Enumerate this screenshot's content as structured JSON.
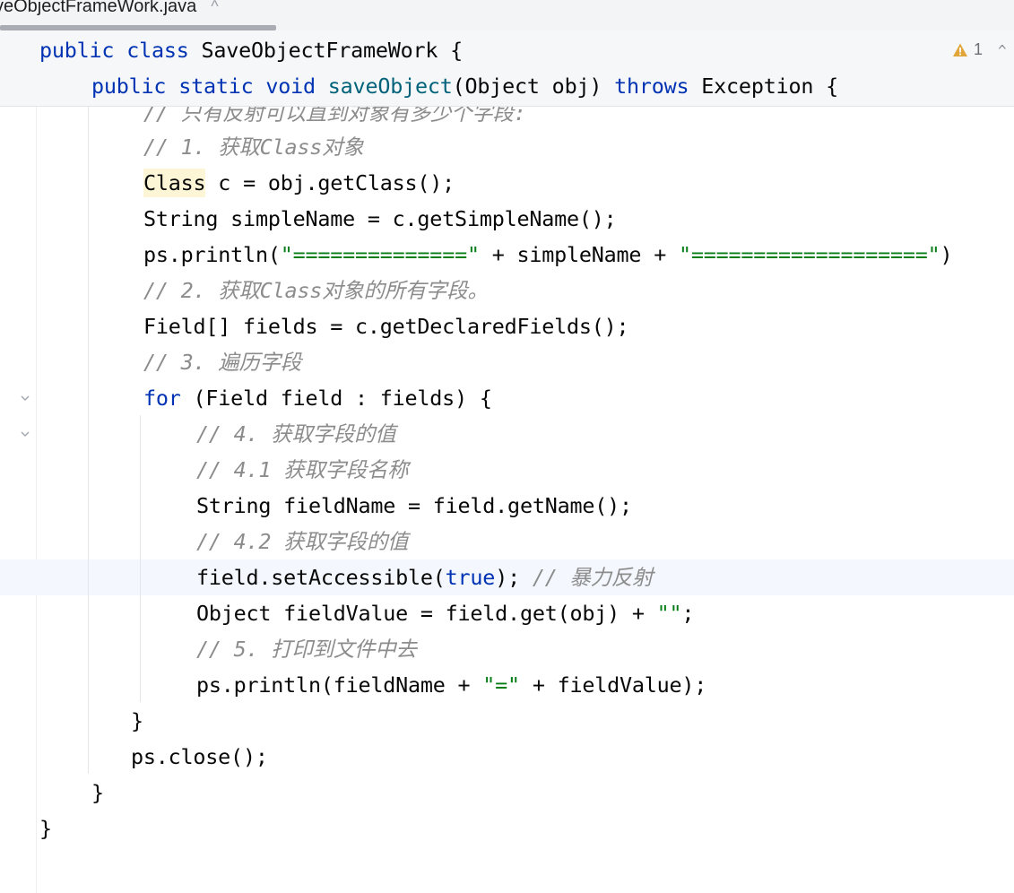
{
  "tab": {
    "title": "veObjectFrameWork.java",
    "close_glyph": "^"
  },
  "inspections": {
    "warning_count": "1",
    "nav_glyph": "^"
  },
  "code": {
    "l0": {
      "kw1": "public",
      "kw2": "class",
      "name": "SaveObjectFrameWork",
      "rest": " {"
    },
    "l1": {
      "kw1": "public",
      "kw2": "static",
      "kw3": "void",
      "fn": "saveObject",
      "mid": "(Object obj) ",
      "kw4": "throws",
      "rest": " Exception {"
    },
    "l2": {
      "cmt": "// 只有反射可以直到对象有多少个字段:"
    },
    "l3": {
      "cmt": "// 1. 获取Class对象"
    },
    "l4": {
      "hl": "Class",
      "rest": " c = obj.getClass();"
    },
    "l5": {
      "text": "String simpleName = c.getSimpleName();"
    },
    "l6": {
      "a": "ps.println(",
      "s1": "\"==============\"",
      "b": " + simpleName + ",
      "s2": "\"===================\"",
      "c": ")"
    },
    "l7": {
      "cmt": "// 2. 获取Class对象的所有字段。"
    },
    "l8": {
      "text": "Field[] fields = c.getDeclaredFields();"
    },
    "l9": {
      "cmt": "// 3. 遍历字段"
    },
    "l10": {
      "kw": "for",
      "rest": " (Field field : fields) {"
    },
    "l11": {
      "cmt": "// 4. 获取字段的值"
    },
    "l12": {
      "cmt": "// 4.1 获取字段名称"
    },
    "l13": {
      "text": "String fieldName = field.getName();"
    },
    "l14": {
      "cmt": "// 4.2 获取字段的值"
    },
    "l15": {
      "a": "field.setAccessible(",
      "kw": "true",
      "b": "); ",
      "cmt": "// 暴力反射"
    },
    "l16": {
      "a": "Object fieldValue = field.get(obj) + ",
      "s": "\"\"",
      "b": ";"
    },
    "l17": {
      "cmt": "// 5. 打印到文件中去"
    },
    "l18": {
      "a": "ps.println(fieldName + ",
      "s": "\"=\"",
      "b": " + fieldValue);"
    },
    "l19": {
      "text": "}"
    },
    "l20": {
      "text": "ps.close();"
    },
    "l21": {
      "text": "}"
    },
    "l22": {
      "text": "}"
    }
  },
  "colors": {
    "keyword": "#0033b3",
    "method": "#00627a",
    "string": "#067d17",
    "comment": "#8c8c8c",
    "warning": "#e2a53a"
  },
  "icons": [
    "chevron-up-icon",
    "warning-icon",
    "fold-icon"
  ]
}
